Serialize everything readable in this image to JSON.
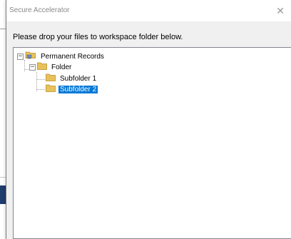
{
  "window": {
    "title": "Secure Accelerator",
    "close_glyph": "✕"
  },
  "instruction": "Please drop your files to workspace folder below.",
  "tree": {
    "root": {
      "label": "Permanent Records",
      "expander": "⊟",
      "icon": "network-folder-icon"
    },
    "folder": {
      "label": "Folder",
      "expander": "⊟",
      "icon": "folder-icon"
    },
    "children": [
      {
        "label": "Subfolder 1",
        "icon": "folder-icon",
        "selected": false
      },
      {
        "label": "Subfolder 2",
        "icon": "folder-icon",
        "selected": true
      }
    ]
  },
  "colors": {
    "selection": "#0078d7",
    "folder": "#e8c15a",
    "background": "#f0f0f0"
  }
}
